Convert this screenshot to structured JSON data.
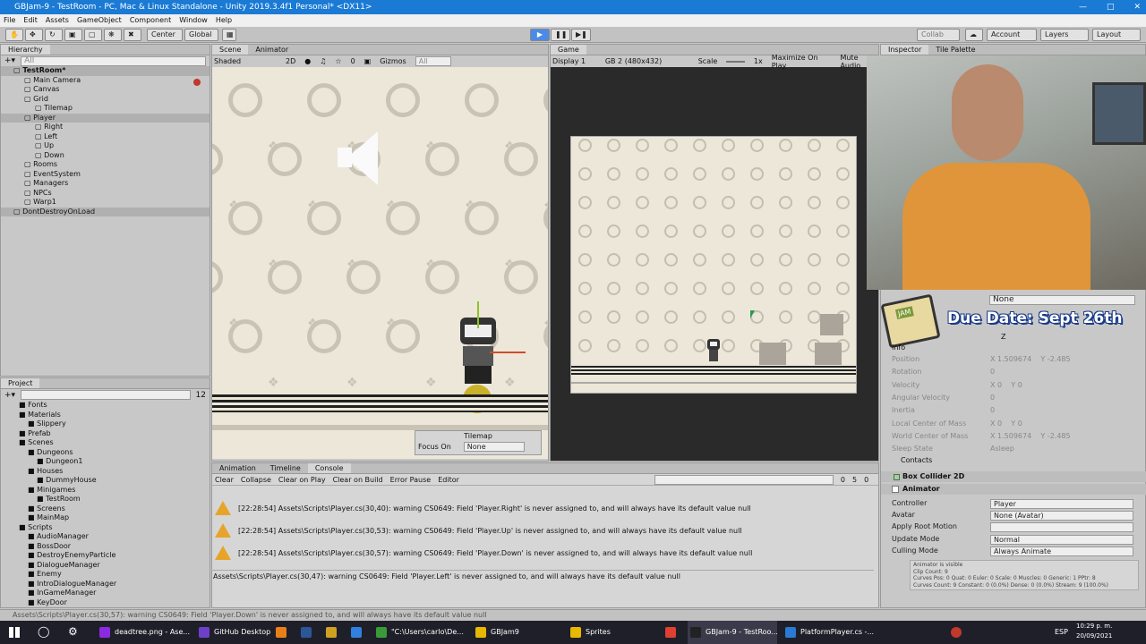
{
  "window": {
    "title": "GBJam-9 - TestRoom - PC, Mac & Linux Standalone - Unity 2019.3.4f1 Personal* <DX11>"
  },
  "menu": [
    "File",
    "Edit",
    "Assets",
    "GameObject",
    "Component",
    "Window",
    "Help"
  ],
  "toolbar": {
    "center": "Center",
    "global": "Global",
    "collab": "Collab",
    "account": "Account",
    "layers": "Layers",
    "layout": "Layout"
  },
  "hierarchy": {
    "tab": "Hierarchy",
    "search": "All",
    "items": [
      {
        "label": "TestRoom*",
        "indent": 0,
        "sel": true,
        "bold": true
      },
      {
        "label": "Main Camera",
        "indent": 1
      },
      {
        "label": "Canvas",
        "indent": 1
      },
      {
        "label": "Grid",
        "indent": 1
      },
      {
        "label": "Tilemap",
        "indent": 2
      },
      {
        "label": "Player",
        "indent": 1,
        "sel": true
      },
      {
        "label": "Right",
        "indent": 2
      },
      {
        "label": "Left",
        "indent": 2
      },
      {
        "label": "Up",
        "indent": 2
      },
      {
        "label": "Down",
        "indent": 2
      },
      {
        "label": "Rooms",
        "indent": 1
      },
      {
        "label": "EventSystem",
        "indent": 1
      },
      {
        "label": "Managers",
        "indent": 1
      },
      {
        "label": "NPCs",
        "indent": 1
      },
      {
        "label": "Warp1",
        "indent": 1
      },
      {
        "label": "DontDestroyOnLoad",
        "indent": 0,
        "sel": true
      }
    ]
  },
  "scene": {
    "tab": "Scene",
    "tab2": "Animator",
    "shaded": "Shaded",
    "mode2d": "2D",
    "gizmos": "Gizmos",
    "search": "All",
    "count": "0",
    "overlay_title": "Tilemap",
    "overlay_focus_label": "Focus On",
    "overlay_focus_value": "None"
  },
  "game": {
    "tab": "Game",
    "display": "Display 1",
    "resolution": "GB 2 (480x432)",
    "scale_label": "Scale",
    "scale_value": "1x",
    "maximize": "Maximize On Play",
    "mute": "Mute Audio"
  },
  "project": {
    "tab": "Project",
    "search": "",
    "count": "12",
    "items": [
      {
        "label": "Fonts",
        "indent": 1
      },
      {
        "label": "Materials",
        "indent": 1
      },
      {
        "label": "Slippery",
        "indent": 2
      },
      {
        "label": "Prefab",
        "indent": 1
      },
      {
        "label": "Scenes",
        "indent": 1
      },
      {
        "label": "Dungeons",
        "indent": 2
      },
      {
        "label": "Dungeon1",
        "indent": 3
      },
      {
        "label": "Houses",
        "indent": 2
      },
      {
        "label": "DummyHouse",
        "indent": 3
      },
      {
        "label": "Minigames",
        "indent": 2
      },
      {
        "label": "TestRoom",
        "indent": 3
      },
      {
        "label": "Screens",
        "indent": 2
      },
      {
        "label": "MainMap",
        "indent": 2
      },
      {
        "label": "Scripts",
        "indent": 1
      },
      {
        "label": "AudioManager",
        "indent": 2
      },
      {
        "label": "BossDoor",
        "indent": 2
      },
      {
        "label": "DestroyEnemyParticle",
        "indent": 2
      },
      {
        "label": "DialogueManager",
        "indent": 2
      },
      {
        "label": "Enemy",
        "indent": 2
      },
      {
        "label": "IntroDialogueManager",
        "indent": 2
      },
      {
        "label": "InGameManager",
        "indent": 2
      },
      {
        "label": "KeyDoor",
        "indent": 2
      }
    ]
  },
  "console": {
    "tabs": [
      "Animation",
      "Timeline",
      "Console"
    ],
    "buttons": [
      "Clear",
      "Collapse",
      "Clear on Play",
      "Clear on Build",
      "Error Pause",
      "Editor"
    ],
    "counts": [
      "0",
      "5",
      "0"
    ],
    "lines": [
      "[22:28:54] Assets\\Scripts\\Player.cs(30,40): warning CS0649: Field 'Player.Right' is never assigned to, and will always have its default value null",
      "[22:28:54] Assets\\Scripts\\Player.cs(30,53): warning CS0649: Field 'Player.Up' is never assigned to, and will always have its default value null",
      "[22:28:54] Assets\\Scripts\\Player.cs(30,57): warning CS0649: Field 'Player.Down' is never assigned to, and will always have its default value null"
    ],
    "detail": "Assets\\Scripts\\Player.cs(30,47): warning CS0649: Field 'Player.Left' is never assigned to, and will always have its default value null"
  },
  "statusbar": "Assets\\Scripts\\Player.cs(30,57): warning CS0649: Field 'Player.Down' is never assigned to, and will always have its default value null",
  "inspector": {
    "tab": "Inspector",
    "tab2": "Tile Palette",
    "mat_value": "None",
    "due_date": "Due Date: Sept 26th",
    "jam_badge": "JAM",
    "info_label": "Info",
    "constraint_z": "Z",
    "rows": [
      {
        "label": "Position",
        "x": "1.509674",
        "y": "-2.485"
      },
      {
        "label": "Rotation",
        "v": "0"
      },
      {
        "label": "Velocity",
        "x": "0",
        "y": "0"
      },
      {
        "label": "Angular Velocity",
        "v": "0"
      },
      {
        "label": "Inertia",
        "v": "0"
      },
      {
        "label": "Local Center of Mass",
        "x": "0",
        "y": "0"
      },
      {
        "label": "World Center of Mass",
        "x": "1.509674",
        "y": "-2.485"
      },
      {
        "label": "Sleep State",
        "v": "Asleep"
      }
    ],
    "contacts": "Contacts",
    "box_collider": "Box Collider 2D",
    "animator": "Animator",
    "anim_rows": [
      {
        "label": "Controller",
        "v": "Player"
      },
      {
        "label": "Avatar",
        "v": "None (Avatar)"
      },
      {
        "label": "Apply Root Motion",
        "v": ""
      },
      {
        "label": "Update Mode",
        "v": "Normal"
      },
      {
        "label": "Culling Mode",
        "v": "Always Animate"
      }
    ],
    "anim_info": [
      "Animator is visible",
      "Clip Count: 9",
      "Curves Pos: 0 Quat: 0 Euler: 0 Scale: 0 Muscles: 0 Generic: 1 PPtr: 8",
      "Curves Count: 9 Constant: 0 (0.0%) Dense: 0 (0.0%) Stream: 9 (100.0%)"
    ]
  },
  "taskbar": {
    "items": [
      {
        "label": "deadtree.png - Ase...",
        "color": "#8a2be2"
      },
      {
        "label": "GitHub Desktop",
        "color": "#6e40c9"
      },
      {
        "label": "",
        "color": "#e8801a"
      },
      {
        "label": "",
        "color": "#2b5797"
      },
      {
        "label": "",
        "color": "#d0a020"
      },
      {
        "label": "",
        "color": "#3080e0"
      },
      {
        "label": "\"C:\\Users\\carlo\\De...",
        "color": "#3a9a3a"
      },
      {
        "label": "GBJam9",
        "color": "#e6b800"
      },
      {
        "label": "Sprites",
        "color": "#e6b800"
      },
      {
        "label": "",
        "color": "#e04030"
      },
      {
        "label": "GBJam-9 - TestRoo...",
        "color": "#222222"
      },
      {
        "label": "PlatformPlayer.cs -...",
        "color": "#2a7ad4"
      }
    ],
    "lang": "ESP",
    "time": "10:29 p. m.",
    "date": "20/09/2021"
  }
}
